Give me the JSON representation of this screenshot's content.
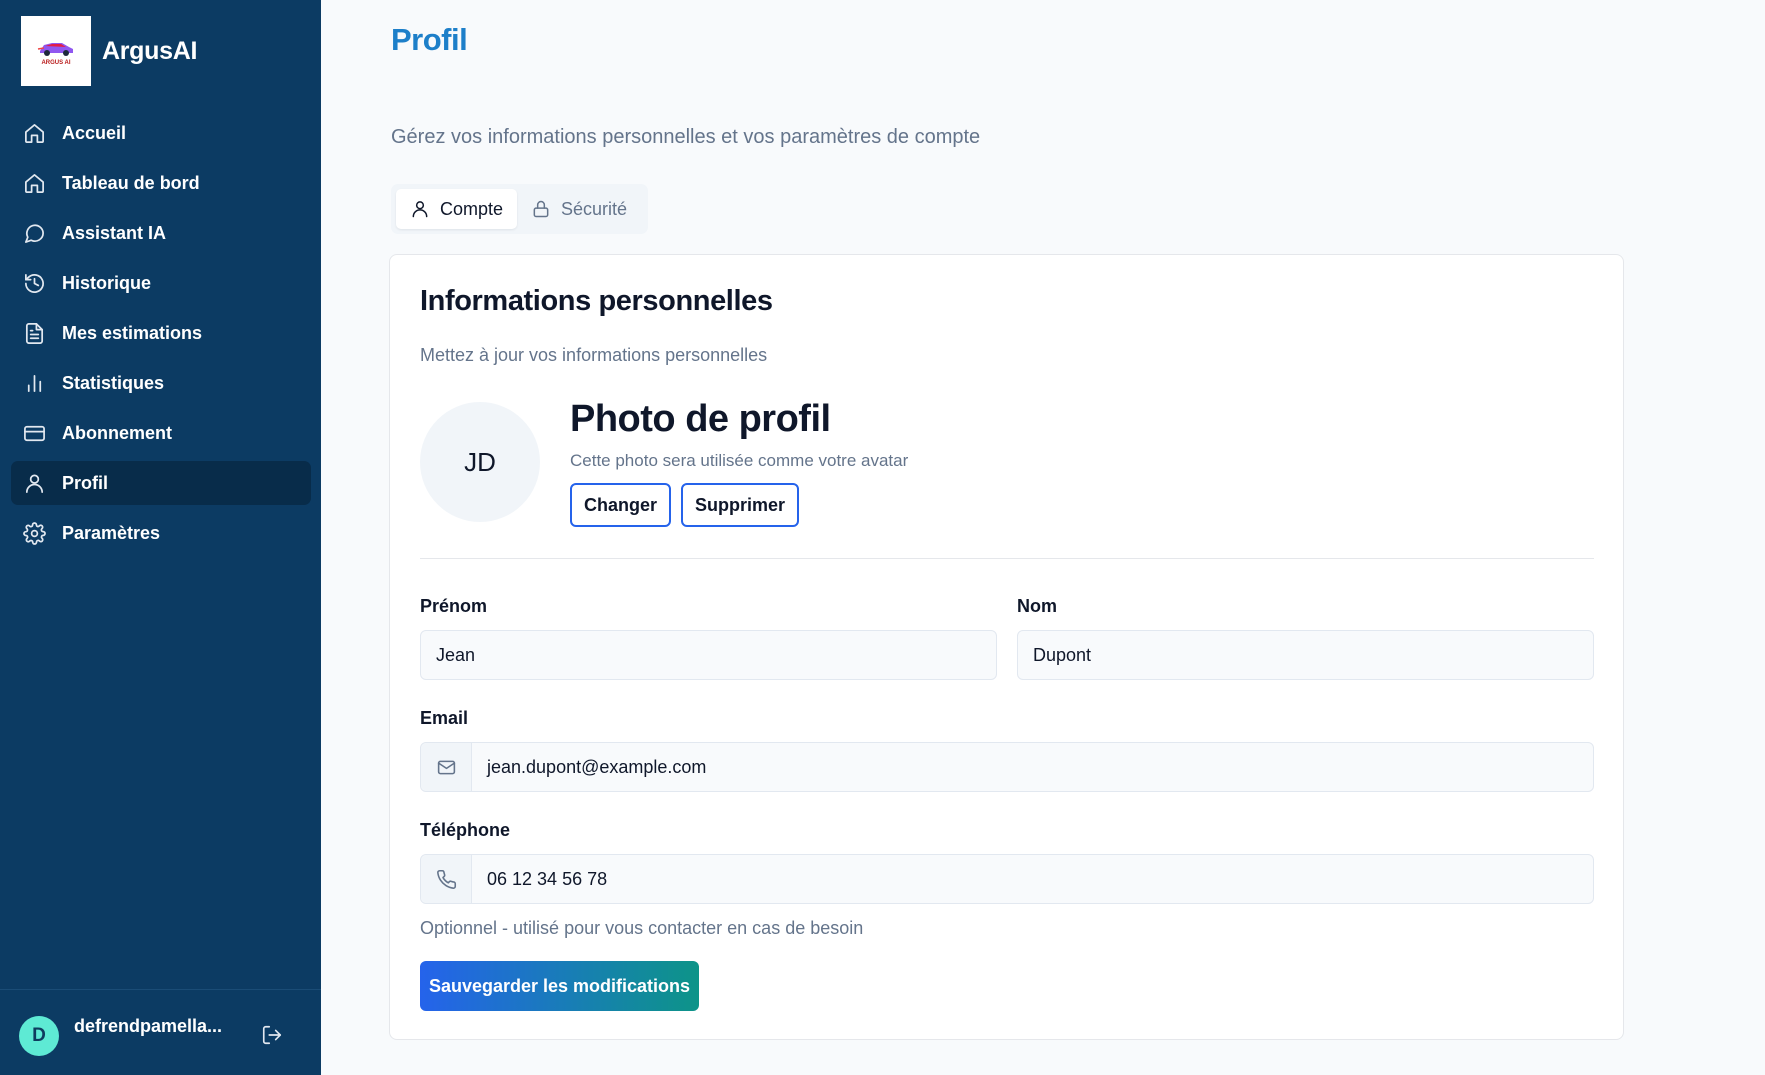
{
  "app": {
    "name": "ArgusAI",
    "logo_text": "ARGUS AI"
  },
  "sidebar": {
    "items": [
      {
        "label": "Accueil",
        "icon": "home-icon"
      },
      {
        "label": "Tableau de bord",
        "icon": "home-icon"
      },
      {
        "label": "Assistant IA",
        "icon": "chat-bubble-icon"
      },
      {
        "label": "Historique",
        "icon": "history-icon"
      },
      {
        "label": "Mes estimations",
        "icon": "document-icon"
      },
      {
        "label": "Statistiques",
        "icon": "bar-chart-icon"
      },
      {
        "label": "Abonnement",
        "icon": "credit-card-icon"
      },
      {
        "label": "Profil",
        "icon": "user-icon",
        "active": true
      },
      {
        "label": "Paramètres",
        "icon": "gear-icon"
      }
    ],
    "user": {
      "initial": "D",
      "name": "defrendpamella..."
    }
  },
  "page": {
    "title": "Profil",
    "subtitle": "Gérez vos informations personnelles et vos paramètres de compte"
  },
  "tabs": [
    {
      "label": "Compte",
      "icon": "user-icon",
      "active": true
    },
    {
      "label": "Sécurité",
      "icon": "lock-icon",
      "active": false
    }
  ],
  "card": {
    "title": "Informations personnelles",
    "description": "Mettez à jour vos informations personnelles",
    "photo": {
      "initials": "JD",
      "title": "Photo de profil",
      "description": "Cette photo sera utilisée comme votre avatar",
      "change_label": "Changer",
      "delete_label": "Supprimer"
    },
    "fields": {
      "first_name": {
        "label": "Prénom",
        "value": "Jean"
      },
      "last_name": {
        "label": "Nom",
        "value": "Dupont"
      },
      "email": {
        "label": "Email",
        "value": "jean.dupont@example.com",
        "icon": "mail-icon"
      },
      "phone": {
        "label": "Téléphone",
        "value": "06 12 34 56 78",
        "icon": "phone-icon",
        "helper": "Optionnel - utilisé pour vous contacter en cas de besoin"
      }
    },
    "save_label": "Sauvegarder les modifications"
  },
  "colors": {
    "sidebar_bg": "#0c3b63",
    "sidebar_active": "#082c4a",
    "title_blue": "#1d7fc9",
    "button_gradient_start": "#2563eb",
    "button_gradient_end": "#0d9488",
    "avatar_teal": "#5eead4"
  }
}
